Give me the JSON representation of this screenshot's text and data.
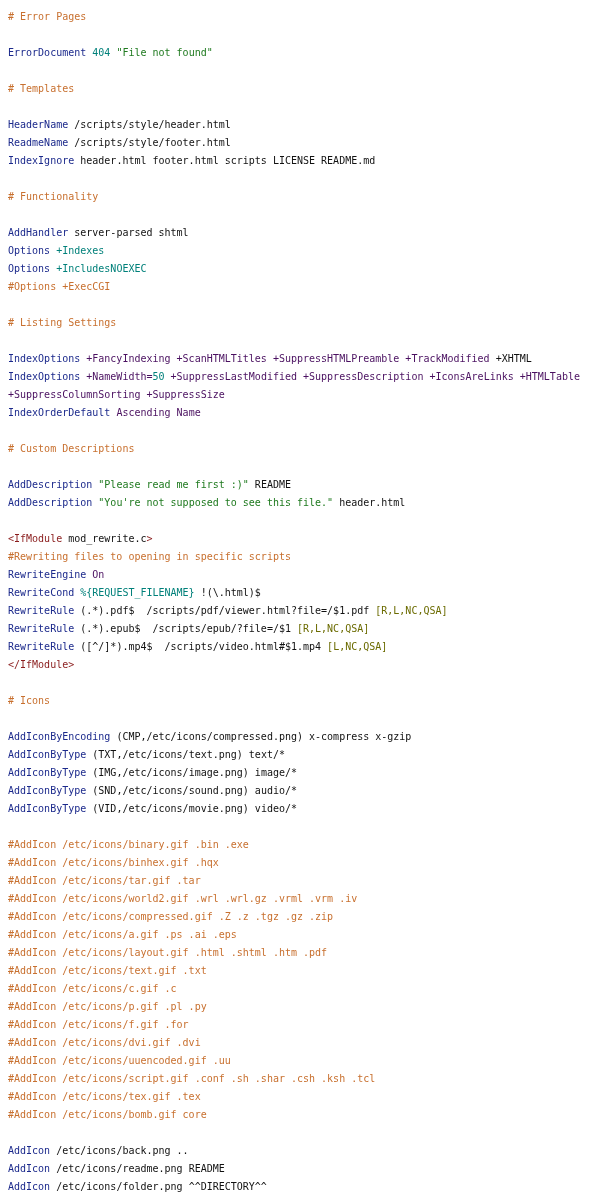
{
  "code_lines": [
    {
      "kind": "code",
      "tokens": [
        {
          "text": "# Error Pages",
          "kind": "comment"
        }
      ]
    },
    {
      "kind": "blank"
    },
    {
      "kind": "code",
      "tokens": [
        {
          "text": "ErrorDocument",
          "kind": "keyword"
        },
        {
          "text": " 404",
          "kind": "number"
        },
        {
          "text": " \"File not found\"",
          "kind": "string"
        }
      ]
    },
    {
      "kind": "blank"
    },
    {
      "kind": "code",
      "tokens": [
        {
          "text": "# Templates",
          "kind": "comment"
        }
      ]
    },
    {
      "kind": "blank"
    },
    {
      "kind": "code",
      "tokens": [
        {
          "text": "HeaderName",
          "kind": "keyword"
        },
        {
          "text": " /scripts/style/header.html",
          "kind": "plain"
        }
      ]
    },
    {
      "kind": "code",
      "tokens": [
        {
          "text": "ReadmeName",
          "kind": "keyword"
        },
        {
          "text": " /scripts/style/footer.html",
          "kind": "plain"
        }
      ]
    },
    {
      "kind": "code",
      "tokens": [
        {
          "text": "IndexIgnore",
          "kind": "keyword"
        },
        {
          "text": " header.html footer.html scripts LICENSE README.md",
          "kind": "plain"
        }
      ]
    },
    {
      "kind": "blank"
    },
    {
      "kind": "code",
      "tokens": [
        {
          "text": "# Functionality",
          "kind": "comment"
        }
      ]
    },
    {
      "kind": "blank"
    },
    {
      "kind": "code",
      "tokens": [
        {
          "text": "AddHandler",
          "kind": "keyword"
        },
        {
          "text": " server-parsed shtml",
          "kind": "plain"
        }
      ]
    },
    {
      "kind": "code",
      "tokens": [
        {
          "text": "Options",
          "kind": "keyword"
        },
        {
          "text": " +Indexes",
          "kind": "value"
        }
      ]
    },
    {
      "kind": "code",
      "tokens": [
        {
          "text": "Options",
          "kind": "keyword"
        },
        {
          "text": " +IncludesNOEXEC",
          "kind": "value"
        }
      ]
    },
    {
      "kind": "code",
      "tokens": [
        {
          "text": "#Options +ExecCGI",
          "kind": "comment"
        }
      ]
    },
    {
      "kind": "blank"
    },
    {
      "kind": "code",
      "tokens": [
        {
          "text": "# Listing Settings",
          "kind": "comment"
        }
      ]
    },
    {
      "kind": "blank"
    },
    {
      "kind": "code",
      "tokens": [
        {
          "text": "IndexOptions",
          "kind": "keyword"
        },
        {
          "text": " +FancyIndexing +ScanHTMLTitles +SuppressHTMLPreamble +TrackModified",
          "kind": "option"
        },
        {
          "text": " +XHTML",
          "kind": "plain"
        }
      ]
    },
    {
      "kind": "code",
      "tokens": [
        {
          "text": "IndexOptions",
          "kind": "keyword"
        },
        {
          "text": " +NameWidth=",
          "kind": "option"
        },
        {
          "text": "50",
          "kind": "number"
        },
        {
          "text": " +SuppressLastModified +SuppressDescription +IconsAreLinks +HTMLTable",
          "kind": "option"
        }
      ]
    },
    {
      "kind": "code",
      "tokens": [
        {
          "text": "+SuppressColumnSorting +SuppressSize",
          "kind": "option"
        }
      ]
    },
    {
      "kind": "code",
      "tokens": [
        {
          "text": "IndexOrderDefault",
          "kind": "keyword"
        },
        {
          "text": " Ascending Name",
          "kind": "option"
        }
      ]
    },
    {
      "kind": "blank"
    },
    {
      "kind": "code",
      "tokens": [
        {
          "text": "# Custom Descriptions",
          "kind": "comment"
        }
      ]
    },
    {
      "kind": "blank"
    },
    {
      "kind": "code",
      "tokens": [
        {
          "text": "AddDescription",
          "kind": "keyword"
        },
        {
          "text": " \"Please read me first :)\"",
          "kind": "string"
        },
        {
          "text": " README",
          "kind": "plain"
        }
      ]
    },
    {
      "kind": "code",
      "tokens": [
        {
          "text": "AddDescription",
          "kind": "keyword"
        },
        {
          "text": " \"You're not supposed to see this file.\"",
          "kind": "string"
        },
        {
          "text": " header.html",
          "kind": "plain"
        }
      ]
    },
    {
      "kind": "blank"
    },
    {
      "kind": "code",
      "tokens": [
        {
          "text": "<IfModule",
          "kind": "tag"
        },
        {
          "text": " mod_rewrite.c",
          "kind": "plain"
        },
        {
          "text": ">",
          "kind": "tag"
        }
      ]
    },
    {
      "kind": "code",
      "tokens": [
        {
          "text": "#Rewriting files to opening in specific scripts",
          "kind": "comment"
        }
      ]
    },
    {
      "kind": "code",
      "tokens": [
        {
          "text": "RewriteEngine",
          "kind": "keyword"
        },
        {
          "text": " On",
          "kind": "option"
        }
      ]
    },
    {
      "kind": "code",
      "tokens": [
        {
          "text": "RewriteCond",
          "kind": "keyword"
        },
        {
          "text": " %{REQUEST_FILENAME}",
          "kind": "value"
        },
        {
          "text": " !(\\.html)$",
          "kind": "plain"
        }
      ]
    },
    {
      "kind": "code",
      "tokens": [
        {
          "text": "RewriteRule",
          "kind": "keyword"
        },
        {
          "text": " (.*).pdf$  /scripts/pdf/viewer.html?file=/$1.pdf ",
          "kind": "plain"
        },
        {
          "text": "[R,L,NC,QSA]",
          "kind": "punct"
        }
      ]
    },
    {
      "kind": "code",
      "tokens": [
        {
          "text": "RewriteRule",
          "kind": "keyword"
        },
        {
          "text": " (.*).epub$  /scripts/epub/?file=/$1 ",
          "kind": "plain"
        },
        {
          "text": "[R,L,NC,QSA]",
          "kind": "punct"
        }
      ]
    },
    {
      "kind": "code",
      "tokens": [
        {
          "text": "RewriteRule",
          "kind": "keyword"
        },
        {
          "text": " ([^/]*).mp4$  /scripts/video.html#$1.mp4 ",
          "kind": "plain"
        },
        {
          "text": "[L,NC,QSA]",
          "kind": "punct"
        }
      ]
    },
    {
      "kind": "code",
      "tokens": [
        {
          "text": "</IfModule>",
          "kind": "tag"
        }
      ]
    },
    {
      "kind": "blank"
    },
    {
      "kind": "code",
      "tokens": [
        {
          "text": "# Icons",
          "kind": "comment"
        }
      ]
    },
    {
      "kind": "blank"
    },
    {
      "kind": "code",
      "tokens": [
        {
          "text": "AddIconByEncoding",
          "kind": "keyword"
        },
        {
          "text": " (CMP,/etc/icons/compressed.png) x-compress x-gzip",
          "kind": "plain"
        }
      ]
    },
    {
      "kind": "code",
      "tokens": [
        {
          "text": "AddIconByType",
          "kind": "keyword"
        },
        {
          "text": " (TXT,/etc/icons/text.png) text/*",
          "kind": "plain"
        }
      ]
    },
    {
      "kind": "code",
      "tokens": [
        {
          "text": "AddIconByType",
          "kind": "keyword"
        },
        {
          "text": " (IMG,/etc/icons/image.png) image/*",
          "kind": "plain"
        }
      ]
    },
    {
      "kind": "code",
      "tokens": [
        {
          "text": "AddIconByType",
          "kind": "keyword"
        },
        {
          "text": " (SND,/etc/icons/sound.png) audio/*",
          "kind": "plain"
        }
      ]
    },
    {
      "kind": "code",
      "tokens": [
        {
          "text": "AddIconByType",
          "kind": "keyword"
        },
        {
          "text": " (VID,/etc/icons/movie.png) video/*",
          "kind": "plain"
        }
      ]
    },
    {
      "kind": "blank"
    },
    {
      "kind": "code",
      "tokens": [
        {
          "text": "#AddIcon /etc/icons/binary.gif .bin .exe",
          "kind": "comment"
        }
      ]
    },
    {
      "kind": "code",
      "tokens": [
        {
          "text": "#AddIcon /etc/icons/binhex.gif .hqx",
          "kind": "comment"
        }
      ]
    },
    {
      "kind": "code",
      "tokens": [
        {
          "text": "#AddIcon /etc/icons/tar.gif .tar",
          "kind": "comment"
        }
      ]
    },
    {
      "kind": "code",
      "tokens": [
        {
          "text": "#AddIcon /etc/icons/world2.gif .wrl .wrl.gz .vrml .vrm .iv",
          "kind": "comment"
        }
      ]
    },
    {
      "kind": "code",
      "tokens": [
        {
          "text": "#AddIcon /etc/icons/compressed.gif .Z .z .tgz .gz .zip",
          "kind": "comment"
        }
      ]
    },
    {
      "kind": "code",
      "tokens": [
        {
          "text": "#AddIcon /etc/icons/a.gif .ps .ai .eps",
          "kind": "comment"
        }
      ]
    },
    {
      "kind": "code",
      "tokens": [
        {
          "text": "#AddIcon /etc/icons/layout.gif .html .shtml .htm .pdf",
          "kind": "comment"
        }
      ]
    },
    {
      "kind": "code",
      "tokens": [
        {
          "text": "#AddIcon /etc/icons/text.gif .txt",
          "kind": "comment"
        }
      ]
    },
    {
      "kind": "code",
      "tokens": [
        {
          "text": "#AddIcon /etc/icons/c.gif .c",
          "kind": "comment"
        }
      ]
    },
    {
      "kind": "code",
      "tokens": [
        {
          "text": "#AddIcon /etc/icons/p.gif .pl .py",
          "kind": "comment"
        }
      ]
    },
    {
      "kind": "code",
      "tokens": [
        {
          "text": "#AddIcon /etc/icons/f.gif .for",
          "kind": "comment"
        }
      ]
    },
    {
      "kind": "code",
      "tokens": [
        {
          "text": "#AddIcon /etc/icons/dvi.gif .dvi",
          "kind": "comment"
        }
      ]
    },
    {
      "kind": "code",
      "tokens": [
        {
          "text": "#AddIcon /etc/icons/uuencoded.gif .uu",
          "kind": "comment"
        }
      ]
    },
    {
      "kind": "code",
      "tokens": [
        {
          "text": "#AddIcon /etc/icons/script.gif .conf .sh .shar .csh .ksh .tcl",
          "kind": "comment"
        }
      ]
    },
    {
      "kind": "code",
      "tokens": [
        {
          "text": "#AddIcon /etc/icons/tex.gif .tex",
          "kind": "comment"
        }
      ]
    },
    {
      "kind": "code",
      "tokens": [
        {
          "text": "#AddIcon /etc/icons/bomb.gif core",
          "kind": "comment"
        }
      ]
    },
    {
      "kind": "blank"
    },
    {
      "kind": "code",
      "tokens": [
        {
          "text": "AddIcon",
          "kind": "keyword"
        },
        {
          "text": " /etc/icons/back.png ..",
          "kind": "plain"
        }
      ]
    },
    {
      "kind": "code",
      "tokens": [
        {
          "text": "AddIcon",
          "kind": "keyword"
        },
        {
          "text": " /etc/icons/readme.png README",
          "kind": "plain"
        }
      ]
    },
    {
      "kind": "code",
      "tokens": [
        {
          "text": "AddIcon",
          "kind": "keyword"
        },
        {
          "text": " /etc/icons/folder.png ^^DIRECTORY^^",
          "kind": "plain"
        }
      ]
    }
  ]
}
